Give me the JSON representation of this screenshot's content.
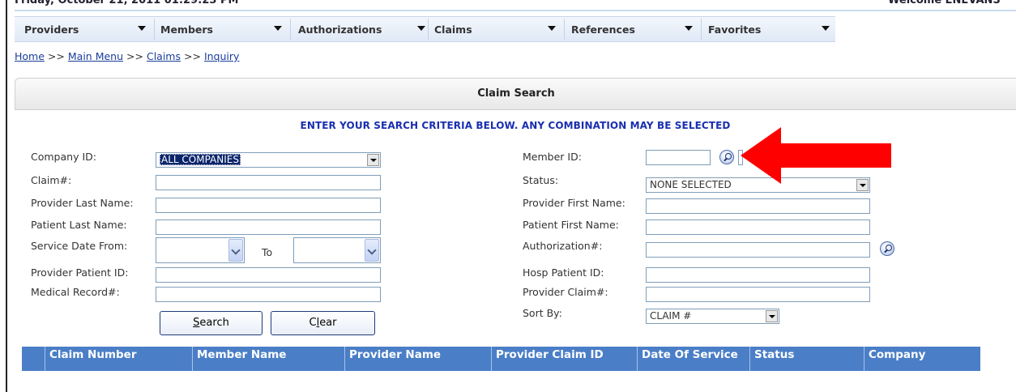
{
  "header": {
    "date_text": "Friday, October 21, 2011 01:29:23 PM",
    "welcome_text": "Welcome ENEVANS"
  },
  "nav": {
    "items": [
      {
        "label": "Providers"
      },
      {
        "label": "Members"
      },
      {
        "label": "Authorizations"
      },
      {
        "label": "Claims"
      },
      {
        "label": "References"
      },
      {
        "label": "Favorites"
      }
    ]
  },
  "breadcrumb": {
    "home": "Home",
    "main_menu": "Main Menu",
    "claims": "Claims",
    "inquiry": "Inquiry",
    "separator": ">>"
  },
  "panel": {
    "title": "Claim Search",
    "instructions": "ENTER YOUR SEARCH CRITERIA BELOW. ANY COMBINATION MAY BE SELECTED"
  },
  "form": {
    "left": {
      "company_id_label": "Company ID:",
      "company_id_value": "ALL COMPANIES",
      "claim_no_label": "Claim#:",
      "claim_no_value": "",
      "provider_last_name_label": "Provider Last Name:",
      "provider_last_name_value": "",
      "patient_last_name_label": "Patient Last Name:",
      "patient_last_name_value": "",
      "service_date_from_label": "Service Date From:",
      "service_date_to_label": "To",
      "service_date_from_value": "",
      "service_date_to_value": "",
      "provider_patient_id_label": "Provider Patient ID:",
      "provider_patient_id_value": "",
      "medical_record_label": "Medical Record#:",
      "medical_record_value": ""
    },
    "right": {
      "member_id_label": "Member ID:",
      "member_id_value": "",
      "status_label": "Status:",
      "status_value": "NONE SELECTED",
      "provider_first_name_label": "Provider First Name:",
      "provider_first_name_value": "",
      "patient_first_name_label": "Patient First Name:",
      "patient_first_name_value": "",
      "authorization_label": "Authorization#:",
      "authorization_value": "",
      "hosp_patient_id_label": "Hosp Patient ID:",
      "hosp_patient_id_value": "",
      "provider_claim_label": "Provider Claim#:",
      "provider_claim_value": "",
      "sort_by_label": "Sort By:",
      "sort_by_value": "CLAIM #"
    },
    "buttons": {
      "search_first": "S",
      "search_rest": "earch",
      "clear_first": "C",
      "clear_u": "l",
      "clear_rest": "ear"
    }
  },
  "results_table": {
    "columns": [
      "Claim Number",
      "Member Name",
      "Provider Name",
      "Provider Claim ID",
      "Date Of Service",
      "Status",
      "Company"
    ]
  },
  "annotation": {
    "arrow_color": "#ff0000"
  },
  "colors": {
    "nav_text": "#1f3a7a",
    "table_header_bg": "#4a7ec7",
    "instructions_text": "#1a2fb0",
    "selected_option_bg": "#0a246a"
  }
}
